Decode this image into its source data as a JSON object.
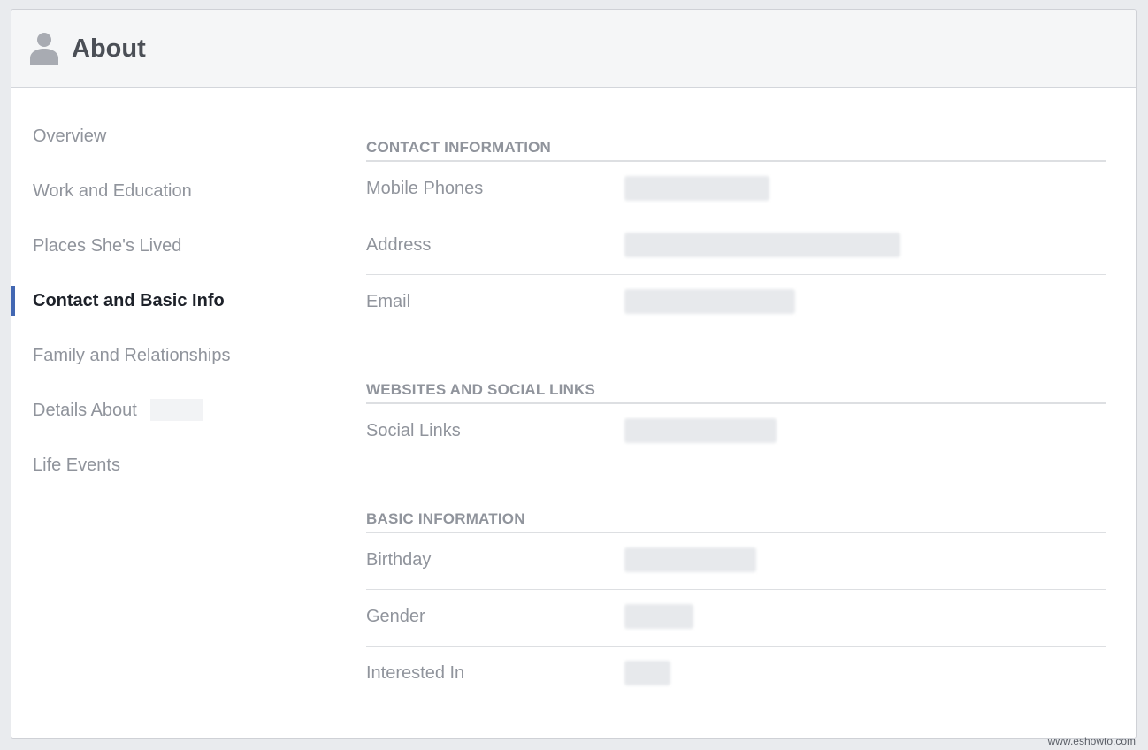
{
  "header": {
    "title": "About",
    "icon": "person-silhouette-icon"
  },
  "sidebar": {
    "items": [
      {
        "label": "Overview",
        "active": false
      },
      {
        "label": "Work and Education",
        "active": false
      },
      {
        "label": "Places She's Lived",
        "active": false
      },
      {
        "label": "Contact and Basic Info",
        "active": true
      },
      {
        "label": "Family and Relationships",
        "active": false
      },
      {
        "label": "Details About",
        "active": false
      },
      {
        "label": "Life Events",
        "active": false
      }
    ]
  },
  "sections": [
    {
      "title": "CONTACT INFORMATION",
      "rows": [
        {
          "label": "Mobile Phones"
        },
        {
          "label": "Address"
        },
        {
          "label": "Email"
        }
      ]
    },
    {
      "title": "WEBSITES AND SOCIAL LINKS",
      "rows": [
        {
          "label": "Social Links"
        }
      ]
    },
    {
      "title": "BASIC INFORMATION",
      "rows": [
        {
          "label": "Birthday"
        },
        {
          "label": "Gender"
        },
        {
          "label": "Interested In"
        }
      ]
    }
  ],
  "watermark": "www.eshowto.com",
  "colors": {
    "accent": "#4267b2",
    "muted_text": "#90949c",
    "active_text": "#1d2129"
  }
}
